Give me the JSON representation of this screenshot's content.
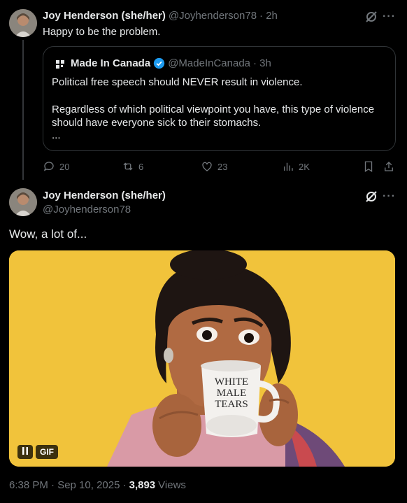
{
  "tweet1": {
    "author_name": "Joy Henderson (she/her)",
    "author_handle": "@Joyhenderson78",
    "time": "· 2h",
    "text": "Happy to be the problem.",
    "quote": {
      "author_name": "Made In Canada",
      "author_handle": "@MadeInCanada",
      "time": "· 3h",
      "para1": "Political free speech should NEVER result in violence.",
      "para2": "Regardless of which political viewpoint you have, this type of violence should have everyone sick to their stomachs.",
      "ellipsis": "..."
    },
    "stats": {
      "replies": "20",
      "reposts": "6",
      "likes": "23",
      "views": "2K"
    }
  },
  "tweet2": {
    "author_name": "Joy Henderson (she/her)",
    "author_handle": "@Joyhenderson78",
    "text": "Wow, a lot of...",
    "mug_text": [
      "WHITE",
      "MALE",
      "TEARS"
    ],
    "gif_label": "GIF",
    "footer_time": "6:38 PM · Sep 10, 2025 ·",
    "footer_views_count": "3,893",
    "footer_views_label": "Views"
  },
  "colors": {
    "background": "#000000",
    "muted": "#71767b",
    "verified": "#1d9bf0",
    "gif_bg": "#f0c23a"
  }
}
